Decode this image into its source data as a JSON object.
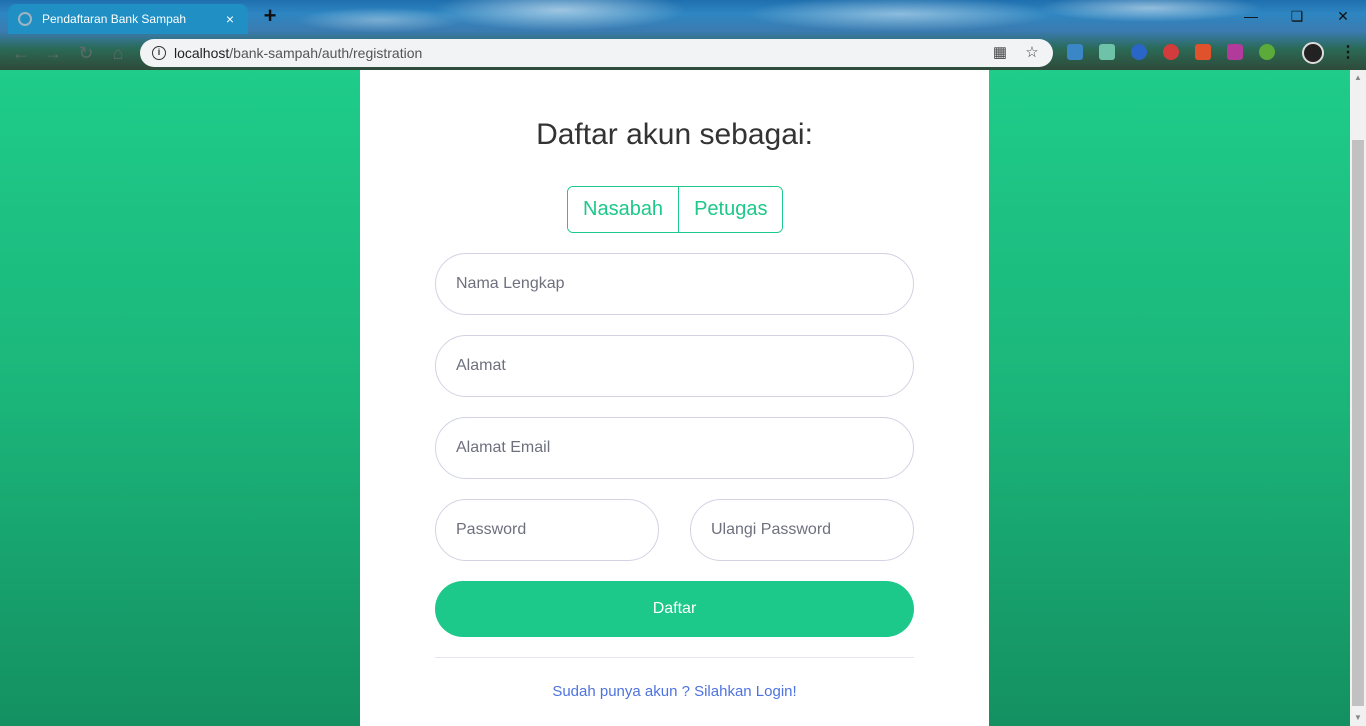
{
  "browser": {
    "tab_title": "Pendaftaran Bank Sampah",
    "tab_close": "×",
    "new_tab": "+",
    "url_host": "localhost",
    "url_path": "/bank-sampah/auth/registration"
  },
  "form": {
    "heading": "Daftar akun sebagai:",
    "roles": [
      "Nasabah",
      "Petugas"
    ],
    "fields": {
      "name_placeholder": "Nama Lengkap",
      "address_placeholder": "Alamat",
      "email_placeholder": "Alamat Email",
      "password_placeholder": "Password",
      "repeat_password_placeholder": "Ulangi Password"
    },
    "submit_label": "Daftar",
    "login_link": "Sudah punya akun ? Silahkan Login!"
  },
  "colors": {
    "accent": "#1cc88a",
    "link": "#4e73df",
    "background_top": "#1fcc8a",
    "background_bottom": "#149061"
  }
}
